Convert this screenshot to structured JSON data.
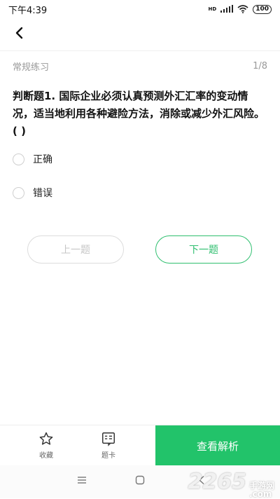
{
  "status_bar": {
    "time": "下午4:39",
    "network_label": "HD",
    "battery": "100"
  },
  "header": {
    "section": "常规练习",
    "progress": "1/8"
  },
  "question": {
    "type_label": "判断题1.",
    "text": " 国际企业必须认真预测外汇汇率的变动情况，适当地利用各种避险方法，消除或减少外汇风险。( )"
  },
  "options": [
    {
      "label": "正确"
    },
    {
      "label": "错误"
    }
  ],
  "buttons": {
    "prev": "上一题",
    "next": "下一题"
  },
  "bottom_bar": {
    "favorite": "收藏",
    "answer_card": "题卡",
    "view_analysis": "查看解析"
  },
  "watermark": {
    "brand": "2265",
    "suffix": ".com",
    "site": "手游网"
  },
  "colors": {
    "accent": "#22c36a",
    "accent_text": "#2fbf6f",
    "disabled": "#c6c6c6"
  }
}
